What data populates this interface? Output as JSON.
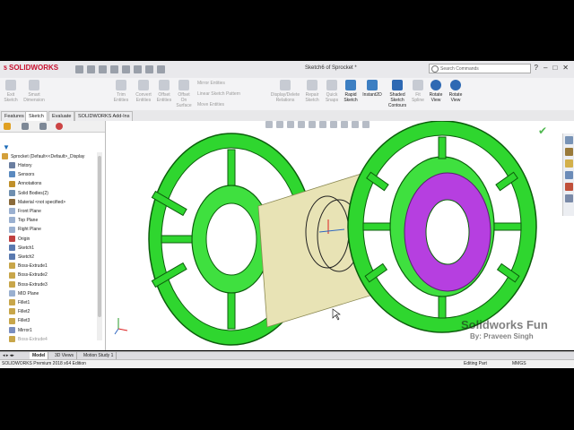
{
  "app": {
    "logo": "SOLIDWORKS",
    "document_title": "Sketch6 of Sprocket *"
  },
  "search": {
    "placeholder": "Search Commands"
  },
  "window_buttons": [
    "?",
    "–",
    "□",
    "✕"
  ],
  "ribbon": {
    "items": [
      {
        "label": "Exit\nSketch"
      },
      {
        "label": "Smart\nDimension"
      },
      {
        "label": "Trim\nEntities"
      },
      {
        "label": "Convert\nEntities"
      },
      {
        "label": "Offset\nEntities"
      },
      {
        "label": "Offset\nOn\nSurface"
      },
      {
        "label": "Mirror Entities"
      },
      {
        "label": "Linear Sketch Pattern"
      },
      {
        "label": "Move Entities"
      },
      {
        "label": "Display/Delete\nRelations"
      },
      {
        "label": "Repair\nSketch"
      },
      {
        "label": "Quick\nSnaps"
      },
      {
        "label": "Rapid\nSketch"
      },
      {
        "label": "Instant2D"
      },
      {
        "label": "Shaded\nSketch\nContours"
      },
      {
        "label": "Fit\nSpline"
      },
      {
        "label": "Rotate\nView"
      },
      {
        "label": "Rotate\nView"
      }
    ]
  },
  "tabs": [
    "Features",
    "Sketch",
    "Evaluate",
    "SOLIDWORKS Add-Ins"
  ],
  "tree": {
    "root": "Sprocket  (Default<<Default>_Display",
    "items": [
      {
        "label": "History",
        "icon": "history-icon"
      },
      {
        "label": "Sensors",
        "icon": "sensor-icon"
      },
      {
        "label": "Annotations",
        "icon": "annotations-icon"
      },
      {
        "label": "Solid Bodies(2)",
        "icon": "solid-bodies-icon"
      },
      {
        "label": "Material <not specified>",
        "icon": "material-icon"
      },
      {
        "label": "Front Plane",
        "icon": "plane-icon"
      },
      {
        "label": "Top Plane",
        "icon": "plane-icon"
      },
      {
        "label": "Right Plane",
        "icon": "plane-icon"
      },
      {
        "label": "Origin",
        "icon": "origin-icon"
      },
      {
        "label": "Sketch1",
        "icon": "sketch-icon"
      },
      {
        "label": "Sketch2",
        "icon": "sketch-icon"
      },
      {
        "label": "Boss-Extrude1",
        "icon": "extrude-icon"
      },
      {
        "label": "Boss-Extrude2",
        "icon": "extrude-icon"
      },
      {
        "label": "Boss-Extrude3",
        "icon": "extrude-icon"
      },
      {
        "label": "MID Plane",
        "icon": "plane-icon"
      },
      {
        "label": "Fillet1",
        "icon": "fillet-icon"
      },
      {
        "label": "Fillet2",
        "icon": "fillet-icon"
      },
      {
        "label": "Fillet3",
        "icon": "fillet-icon"
      },
      {
        "label": "Mirror1",
        "icon": "mirror-icon"
      },
      {
        "label": "Boss-Extrude4",
        "icon": "extrude-icon"
      }
    ]
  },
  "bottom_tabs": [
    "Model",
    "3D Views",
    "Motion Study 1"
  ],
  "status": {
    "edition": "SOLIDWORKS Premium 2018 x64 Edition",
    "mode": "Editing Part",
    "units": "MMGS"
  },
  "watermark": {
    "title": "Solidworks Fun",
    "byline": "By: Praveen Singh"
  },
  "colors": {
    "sprocket": "#2fd62f",
    "sprocket_edge": "#0c5e0c",
    "hub_face": "#b63fe0",
    "shaft": "#d9d59a"
  }
}
